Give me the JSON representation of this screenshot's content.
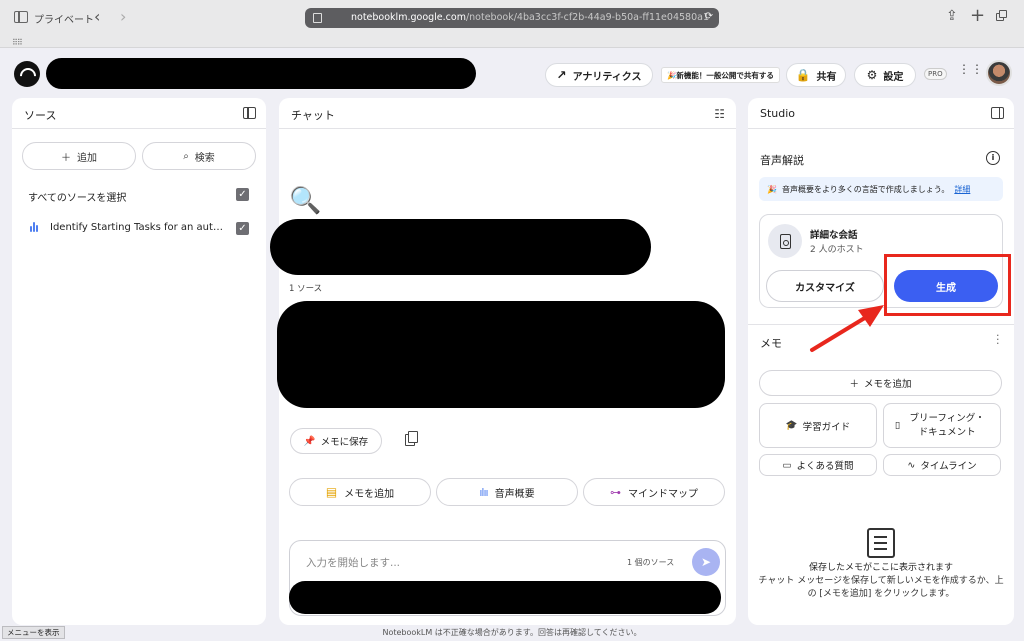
{
  "browser": {
    "private_label": "プライベート",
    "url_host": "notebooklm.google.com",
    "url_path": "/notebook/4ba3cc3f-cf2b-44a9-b50a-ff11e04580a1"
  },
  "header": {
    "analytics_label": "アナリティクス",
    "new_feature_banner": "🎉新機能！一般公開で共有する",
    "share_label": "共有",
    "settings_label": "設定",
    "pro_badge": "PRO"
  },
  "sources": {
    "title": "ソース",
    "add_label": "追加",
    "search_label": "検索",
    "select_all_label": "すべてのソースを選択",
    "items": [
      {
        "name": "Identify Starting Tasks for an author-d...",
        "checked": true
      }
    ]
  },
  "chat": {
    "title": "チャット",
    "source_count": "1 ソース",
    "save_memo_label": "メモに保存",
    "actions": {
      "add_memo": "メモを追加",
      "audio_overview": "音声概要",
      "mind_map": "マインドマップ"
    },
    "input_placeholder": "入力を開始します...",
    "input_source_count": "1 個のソース"
  },
  "studio": {
    "title": "Studio",
    "audio_title": "音声解説",
    "audio_banner_text": "音声概要をより多くの言語で作成しましょう。",
    "audio_banner_link": "詳細",
    "card_title": "詳細な会話",
    "card_subtitle": "2 人のホスト",
    "customize_label": "カスタマイズ",
    "generate_label": "生成",
    "memo_title": "メモ",
    "add_memo_label": "メモを追加",
    "study_guide": "学習ガイド",
    "briefing_doc": "ブリーフィング・ドキュメント",
    "faq": "よくある質問",
    "timeline": "タイムライン",
    "empty_title": "保存したメモがここに表示されます",
    "empty_body": "チャット メッセージを保存して新しいメモを作成するか、上の [メモを追加] をクリックします。"
  },
  "footer": {
    "menu_tooltip": "メニューを表示",
    "disclaimer": "NotebookLM は不正確な場合があります。回答は再確認してください。"
  },
  "colors": {
    "accent": "#3b5ff2",
    "highlight": "#e8271d",
    "background": "#efeff5"
  }
}
